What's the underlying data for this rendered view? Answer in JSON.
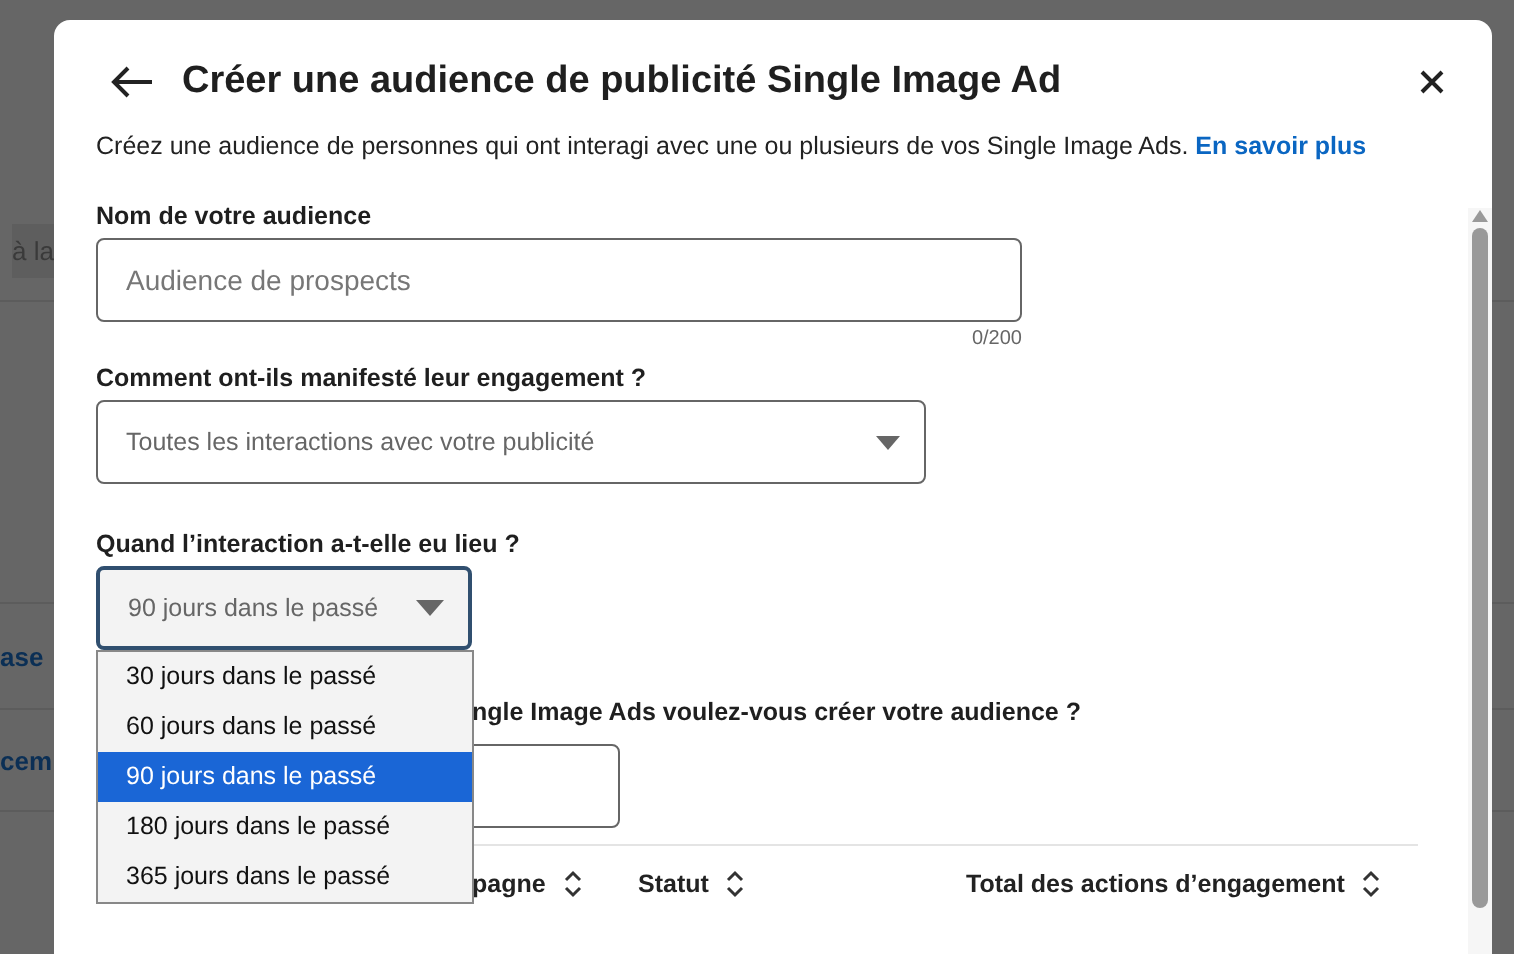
{
  "background": {
    "fragments": [
      "à la",
      "ase",
      "cem"
    ]
  },
  "dialog": {
    "title": "Créer une audience de publicité Single Image Ad",
    "description": {
      "text": "Créez une audience de personnes qui ont interagi avec une ou plusieurs de vos Single Image Ads.",
      "link": "En savoir plus"
    },
    "name_field": {
      "label": "Nom de votre audience",
      "placeholder": "Audience de prospects",
      "counter": "0/200"
    },
    "engagement_field": {
      "label": "Comment ont-ils manifesté leur engagement ?",
      "value": "Toutes les interactions avec votre publicité"
    },
    "period_field": {
      "label": "Quand l’interaction a-t-elle eu lieu ?",
      "value": "90 jours dans le passé",
      "expanded": true,
      "options": [
        {
          "label": "30 jours dans le passé",
          "selected": false
        },
        {
          "label": "60 jours dans le passé",
          "selected": false
        },
        {
          "label": "90 jours dans le passé",
          "selected": true
        },
        {
          "label": "180 jours dans le passé",
          "selected": false
        },
        {
          "label": "365 jours dans le passé",
          "selected": false
        }
      ]
    },
    "ads_field": {
      "label": "ngle Image Ads voulez-vous créer votre audience ?"
    },
    "table": {
      "columns": [
        "pagne",
        "Statut",
        "Total des actions d’engagement"
      ]
    }
  }
}
